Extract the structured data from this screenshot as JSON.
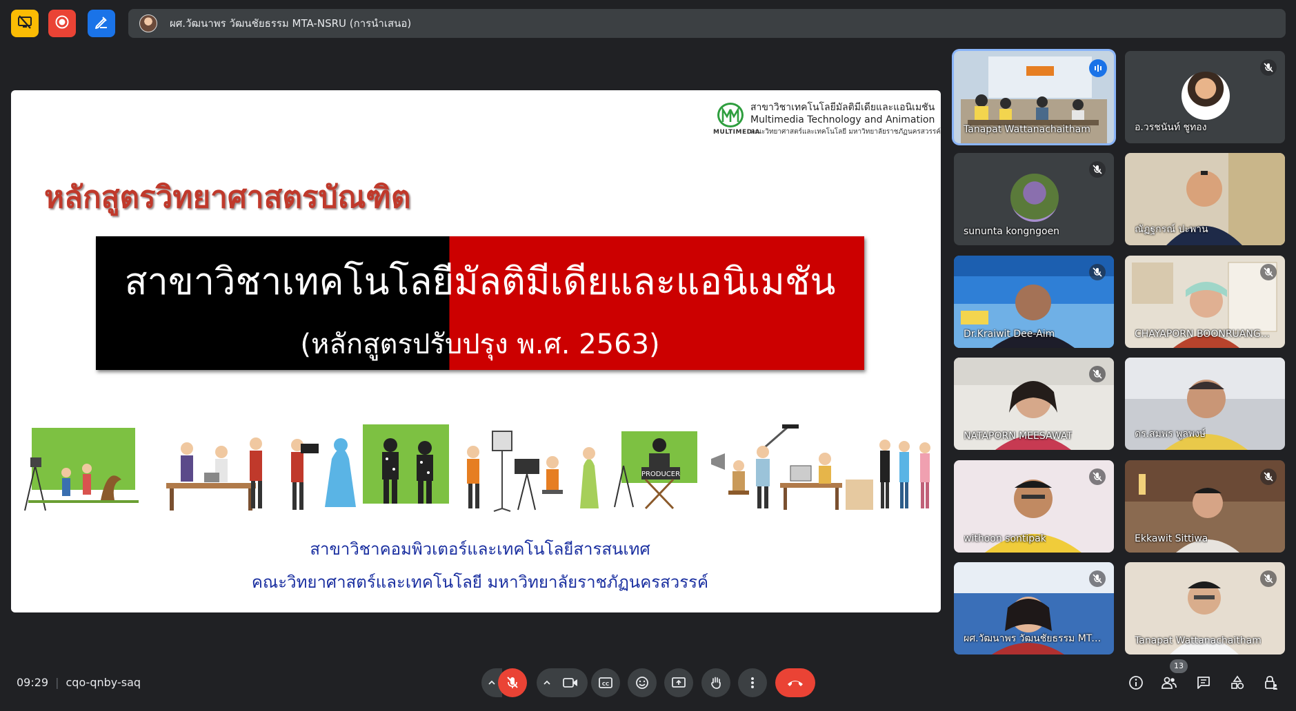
{
  "topbar": {
    "presenter_label": "ผศ.วัฒนาพร วัฒนชัยธรรม MTA-NSRU (การนำเสนอ)"
  },
  "slide": {
    "logo_text": "MULTIMEDIA",
    "logo_line1": "สาขาวิชาเทคโนโลยีมัลติมีเดียและแอนิเมชัน",
    "logo_line2": "Multimedia Technology and Animation",
    "logo_line3": "คณะวิทยาศาสตร์และเทคโนโลยี มหาวิทยาลัยราชภัฏนครสวรรค์",
    "heading": "หลักสูตรวิทยาศาสตรบัณฑิต",
    "banner_title": "สาขาวิชาเทคโนโลยีมัลติมีเดียและแอนิเมชัน",
    "banner_subtitle": "(หลักสูตรปรับปรุง พ.ศ. 2563)",
    "illustration_label": "PRODUCER",
    "footer_line1": "สาขาวิชาคอมพิวเตอร์และเทคโนโลยีสารสนเทศ",
    "footer_line2": "คณะวิทยาศาสตร์และเทคโนโลยี มหาวิทยาลัยราชภัฏนครสวรรค์"
  },
  "participants": [
    {
      "name": "Tanapat Wattanachaitham",
      "speaking": true
    },
    {
      "name": "อ.วรชนันท์ ชูทอง",
      "muted": true
    },
    {
      "name": "sununta kongngoen",
      "muted": true
    },
    {
      "name": "ณัฏฐกรณ์ ปะพาน",
      "muted": false
    },
    {
      "name": "Dr.Kraiwit Dee-Aim",
      "muted": true
    },
    {
      "name": "CHAYAPORN BOONRUANG...",
      "muted": true
    },
    {
      "name": "NATAPORN MEESAWAT",
      "muted": true
    },
    {
      "name": "ดร.สมพร พูลพงษ์",
      "muted": false
    },
    {
      "name": "withoon sontipak",
      "muted": true
    },
    {
      "name": "Ekkawit Sittiwa",
      "muted": true
    },
    {
      "name": "ผศ.วัฒนาพร วัฒนชัยธรรม MTA...",
      "muted": true
    },
    {
      "name": "Tanapat Wattanachaitham",
      "muted": true
    }
  ],
  "bottombar": {
    "time": "09:29",
    "meeting_code": "cqo-qnby-saq",
    "people_count": "13"
  },
  "colors": {
    "background": "#202124",
    "control": "#3c4043",
    "danger": "#ea4335",
    "accent": "#8ab4f8"
  }
}
